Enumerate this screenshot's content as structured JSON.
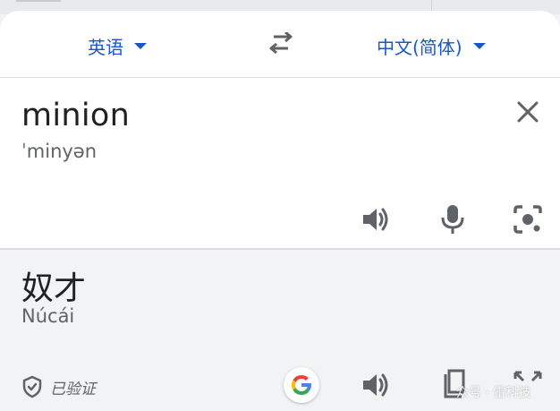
{
  "languages": {
    "source": "英语",
    "target": "中文(简体)"
  },
  "source": {
    "text": "minion",
    "phonetic": "ˈminyən"
  },
  "target": {
    "text": "奴才",
    "romanization": "Núcái",
    "verified_label": "已验证"
  },
  "watermark": "众号 · 雷科技",
  "icons": {
    "swap": "swap-arrows-icon",
    "close": "close-icon",
    "speaker": "speaker-icon",
    "mic": "mic-icon",
    "camera": "camera-lens-icon",
    "shield": "shield-check-icon",
    "google": "google-g-icon",
    "copy": "copy-icon",
    "fullscreen": "fullscreen-icon"
  },
  "colors": {
    "accent": "#1a56c4",
    "icon": "#5f6368",
    "target_bg": "#f1f3f4"
  }
}
